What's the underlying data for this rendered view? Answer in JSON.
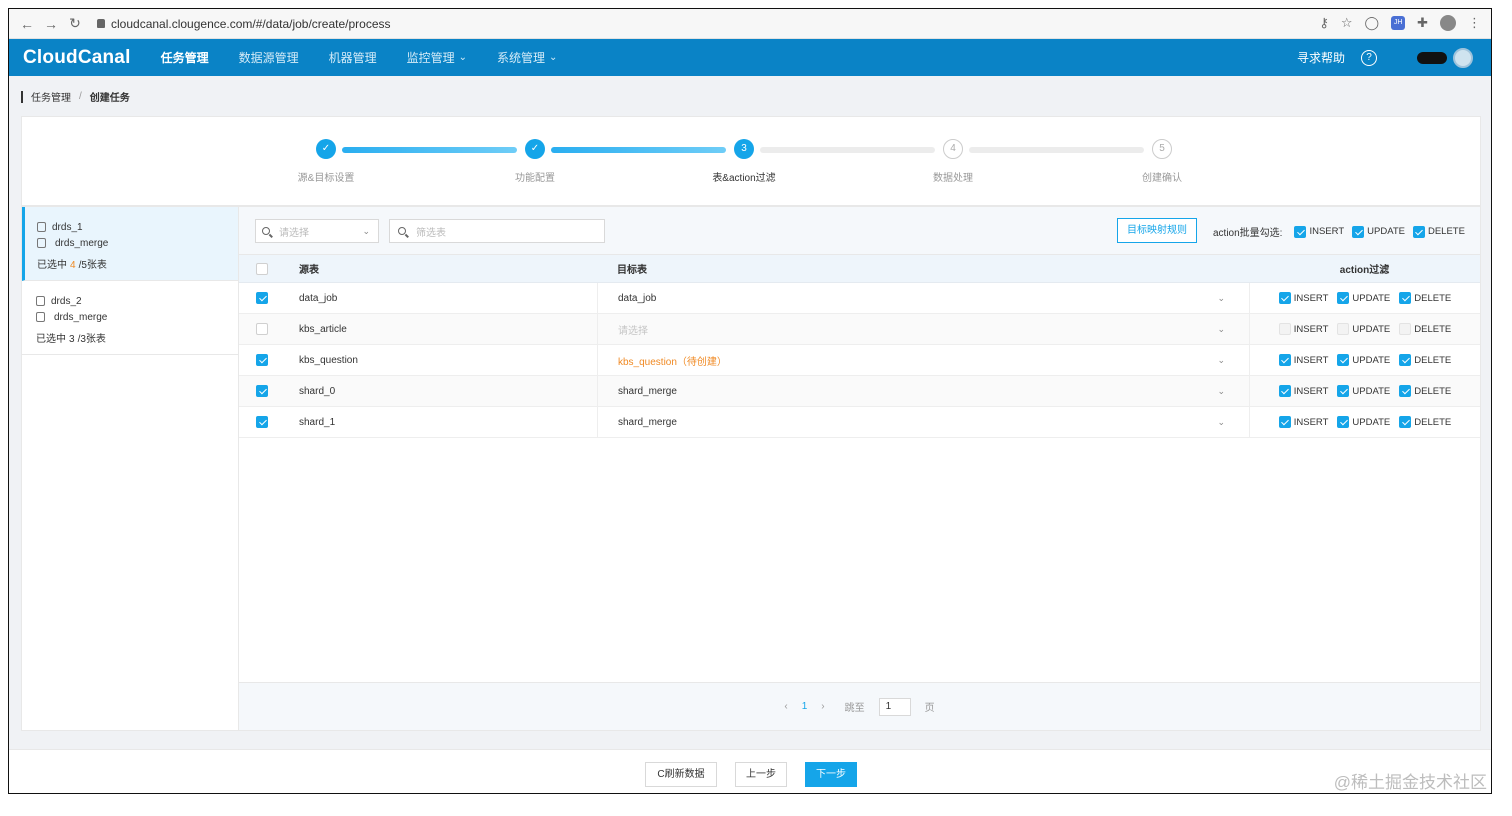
{
  "browser": {
    "url": "cloudcanal.clougence.com/#/data/job/create/process",
    "ext_label": "JH"
  },
  "header": {
    "logo": "CloudCanal",
    "nav": [
      {
        "label": "任务管理",
        "active": true,
        "has_dropdown": false
      },
      {
        "label": "数据源管理",
        "active": false,
        "has_dropdown": false
      },
      {
        "label": "机器管理",
        "active": false,
        "has_dropdown": false
      },
      {
        "label": "监控管理",
        "active": false,
        "has_dropdown": true
      },
      {
        "label": "系统管理",
        "active": false,
        "has_dropdown": true
      }
    ],
    "help": "寻求帮助",
    "help_icon": "?"
  },
  "breadcrumb": {
    "parent": "任务管理",
    "separator": "/",
    "current": "创建任务"
  },
  "steps": [
    {
      "num": "✓",
      "label": "源&目标设置",
      "state": "done"
    },
    {
      "num": "✓",
      "label": "功能配置",
      "state": "done"
    },
    {
      "num": "3",
      "label": "表&action过滤",
      "state": "active"
    },
    {
      "num": "4",
      "label": "数据处理",
      "state": "todo"
    },
    {
      "num": "5",
      "label": "创建确认",
      "state": "todo"
    }
  ],
  "databases": [
    {
      "name": "drds_1",
      "target": "drds_merge",
      "prefix": "已选中",
      "selected_count": "4",
      "total": "/5张表",
      "selected": true
    },
    {
      "name": "drds_2",
      "target": "drds_merge",
      "prefix": "已选中",
      "selected_count": "3",
      "total": "/3张表",
      "selected": false
    }
  ],
  "filter": {
    "select_placeholder": "请选择",
    "search_placeholder": "筛选表",
    "map_rule_button": "目标映射规则",
    "batch_label": "action批量勾选:",
    "actions": [
      "INSERT",
      "UPDATE",
      "DELETE"
    ]
  },
  "table": {
    "headers": {
      "source": "源表",
      "target": "目标表",
      "action": "action过滤"
    },
    "rows": [
      {
        "checked": true,
        "source": "data_job",
        "target": "data_job",
        "target_state": "normal",
        "actions": [
          true,
          true,
          true
        ]
      },
      {
        "checked": false,
        "source": "kbs_article",
        "target": "请选择",
        "target_state": "placeholder",
        "actions": [
          false,
          false,
          false
        ]
      },
      {
        "checked": true,
        "source": "kbs_question",
        "target": "kbs_question（待创建）",
        "target_state": "pending",
        "actions": [
          true,
          true,
          true
        ]
      },
      {
        "checked": true,
        "source": "shard_0",
        "target": "shard_merge",
        "target_state": "normal",
        "actions": [
          true,
          true,
          true
        ]
      },
      {
        "checked": true,
        "source": "shard_1",
        "target": "shard_merge",
        "target_state": "normal",
        "actions": [
          true,
          true,
          true
        ]
      }
    ]
  },
  "pagination": {
    "prev": "‹",
    "page": "1",
    "next": "›",
    "jump_label": "跳至",
    "jump_value": "1",
    "page_unit": "页"
  },
  "footer": {
    "refresh": "C刷新数据",
    "prev": "上一步",
    "next": "下一步"
  },
  "watermark": "@稀土掘金技术社区",
  "colors": {
    "header_bg": "#0a83c6",
    "accent": "#15a5e9",
    "pending": "#f08a24"
  }
}
